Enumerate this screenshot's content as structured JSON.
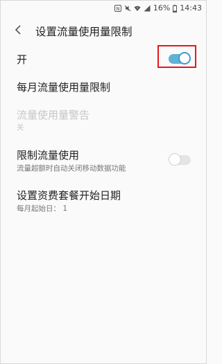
{
  "status_bar": {
    "battery_percent": "16%",
    "time": "14:43",
    "icons": [
      "nfc-icon",
      "mute-icon",
      "wifi-icon",
      "signal-icon",
      "battery-icon"
    ]
  },
  "header": {
    "back_icon": "chevron-left-icon",
    "title": "设置流量使用量限制"
  },
  "rows": {
    "toggle_main": {
      "label": "开",
      "state": "on"
    },
    "monthly_limit": {
      "label": "每月流量使用量限制"
    },
    "usage_warning": {
      "label": "流量使用量警告",
      "sub": "关",
      "enabled": false
    },
    "limit_usage": {
      "label": "限制流量使用",
      "sub": "流量超额时自动关闭移动数据功能",
      "state": "off"
    },
    "billing_start": {
      "label": "设置资费套餐开始日期",
      "sub": "每月起始日： 1"
    }
  },
  "colors": {
    "accent": "#5fb1d6",
    "highlight": "#e8141d"
  }
}
